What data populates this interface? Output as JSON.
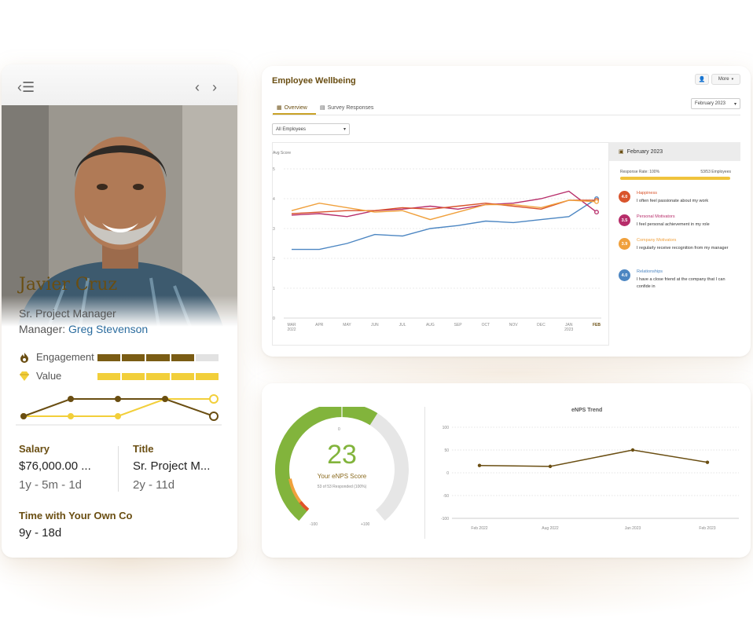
{
  "profile": {
    "name": "Javier Cruz",
    "role": "Sr. Project Manager",
    "manager_prefix": "Manager:",
    "manager_name": "Greg Stevenson",
    "engagement_label": "Engagement",
    "engagement_level": 0.8,
    "value_label": "Value",
    "value_level": 1.0,
    "salary_label": "Salary",
    "salary_value": "$76,000.00 ...",
    "salary_tenure": "1y - 5m - 1d",
    "title_label": "Title",
    "title_value": "Sr. Project M...",
    "title_tenure": "2y - 11d",
    "time_label": "Time with Your Own Co",
    "time_value": "9y - 18d",
    "trend_engagement": [
      1,
      2,
      2,
      2,
      1
    ],
    "trend_value": [
      1,
      1,
      1,
      2,
      2
    ],
    "colors": {
      "accent": "#6a4e12",
      "value": "#f2cf3a",
      "link": "#2b6c9e"
    }
  },
  "wellbeing": {
    "title": "Employee Wellbeing",
    "more_label": "More",
    "tabs": [
      {
        "label": "Overview"
      },
      {
        "label": "Survey Responses"
      }
    ],
    "period_select": "February 2023",
    "filter_select": "All Employees",
    "side_title": "February 2023",
    "response_rate": "Response Rate: 100%",
    "response_count": "53/53 Employees",
    "items": [
      {
        "score": "4.0",
        "category": "Happiness",
        "text": "I often feel passionate about my work",
        "color": "#d9542c"
      },
      {
        "score": "3.5",
        "category": "Personal Motivators",
        "text": "I feel personal achievement in my role",
        "color": "#b72d6a"
      },
      {
        "score": "3.9",
        "category": "Company Motivators",
        "text": "I regularly receive recognition from my manager",
        "color": "#f0a03c"
      },
      {
        "score": "4.0",
        "category": "Relationships",
        "text": "I have a close friend at the company that I can confide in",
        "color": "#4c86c2"
      }
    ]
  },
  "chart_data": [
    {
      "type": "line",
      "ylabel": "Avg Score",
      "ylim": [
        0,
        5
      ],
      "yticks": [
        "0",
        "1",
        "2",
        "3",
        "4",
        "5"
      ],
      "categories": [
        "MAR 2022",
        "APR",
        "MAY",
        "JUN",
        "JUL",
        "AUG",
        "SEP",
        "OCT",
        "NOV",
        "DEC",
        "JAN 2023",
        "FEB"
      ],
      "category_labels": [
        [
          "MAR",
          "2022"
        ],
        [
          "APR"
        ],
        [
          "MAY"
        ],
        [
          "JUN"
        ],
        [
          "JUL"
        ],
        [
          "AUG"
        ],
        [
          "SEP"
        ],
        [
          "OCT"
        ],
        [
          "NOV"
        ],
        [
          "DEC"
        ],
        [
          "JAN",
          "2023"
        ],
        [
          "FEB"
        ]
      ],
      "series": [
        {
          "color": "#4c86c2",
          "values": [
            2.3,
            2.3,
            2.5,
            2.8,
            2.75,
            3.0,
            3.1,
            3.25,
            3.2,
            3.3,
            3.4,
            4.0
          ]
        },
        {
          "color": "#b72d6a",
          "values": [
            3.45,
            3.5,
            3.4,
            3.6,
            3.65,
            3.75,
            3.65,
            3.8,
            3.85,
            4.0,
            4.25,
            3.55
          ]
        },
        {
          "color": "#d9542c",
          "values": [
            3.5,
            3.55,
            3.6,
            3.6,
            3.7,
            3.65,
            3.75,
            3.85,
            3.75,
            3.65,
            3.95,
            3.95
          ]
        },
        {
          "color": "#f0a03c",
          "values": [
            3.6,
            3.85,
            3.7,
            3.55,
            3.6,
            3.3,
            3.55,
            3.8,
            3.8,
            3.7,
            3.95,
            3.9
          ]
        }
      ],
      "grid": true
    },
    {
      "type": "line",
      "title": "eNPS Trend",
      "ylim": [
        -100,
        100
      ],
      "yticks": [
        "100",
        "50",
        "0",
        "-50",
        "-100"
      ],
      "categories": [
        "Feb 2022",
        "Aug 2022",
        "Jan 2023",
        "Feb 2023"
      ],
      "series": [
        {
          "color": "#6a4e12",
          "values": [
            16,
            14,
            50,
            23
          ]
        }
      ],
      "grid": true
    }
  ],
  "enps": {
    "score": "23",
    "label": "Your eNPS Score",
    "sublabel": "53 of 53 Responded (100%)",
    "gauge_zero": "0",
    "gauge_left": "-100",
    "gauge_right": "+100",
    "score_fraction": 0.615,
    "colors": {
      "green": "#82b43c",
      "track": "#e6e6e6"
    }
  }
}
